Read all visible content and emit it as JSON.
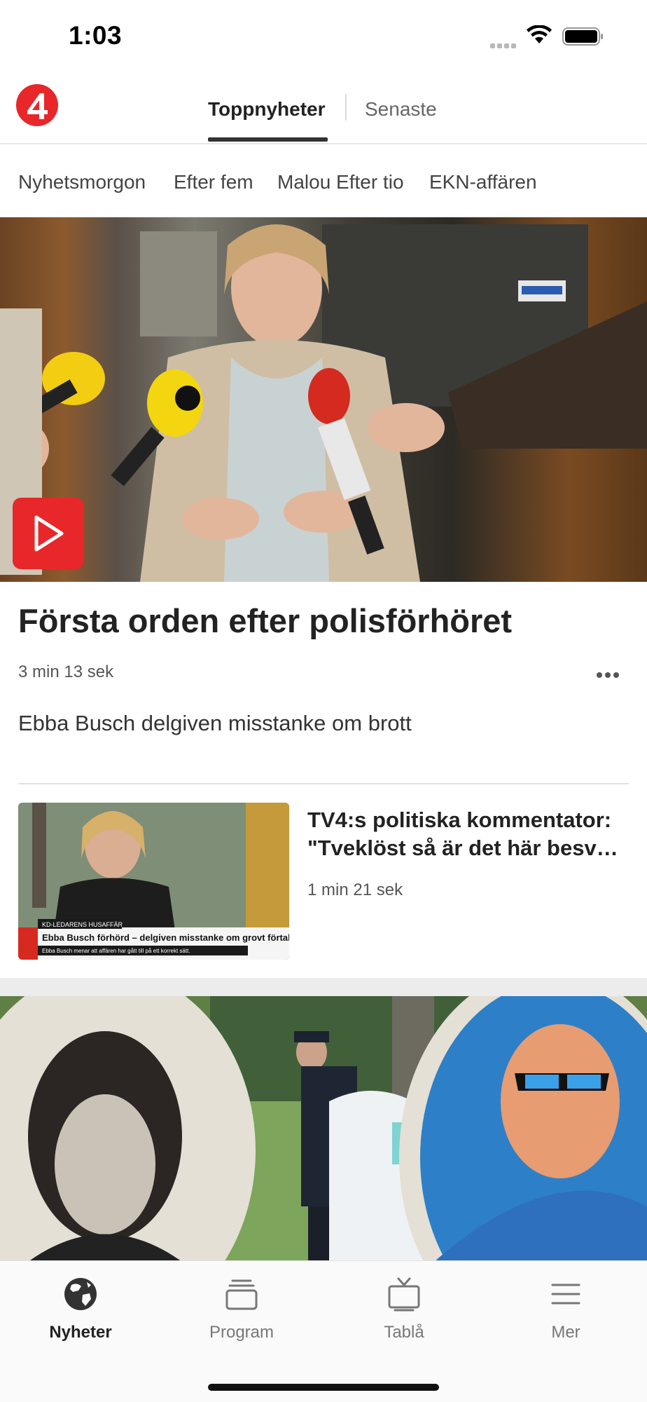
{
  "status_bar": {
    "time": "1:03"
  },
  "header": {
    "logo_icon": "tv4-logo-icon",
    "tabs": [
      {
        "label": "Toppnyheter",
        "active": true
      },
      {
        "label": "Senaste",
        "active": false
      }
    ]
  },
  "subnav": {
    "items": [
      {
        "label": "Nyhetsmorgon"
      },
      {
        "label": "Efter fem"
      },
      {
        "label": "Malou Efter tio"
      },
      {
        "label": "EKN-affären"
      }
    ]
  },
  "hero": {
    "title": "Första orden efter polisförhöret",
    "duration": "3 min 13 sek",
    "subtitle": "Ebba Busch delgiven misstanke om brott",
    "play_icon": "play-icon",
    "more_icon": "more-dots-icon"
  },
  "article2": {
    "title_line1": "TV4:s politiska kommentator:",
    "title_line2": "\"Tveklöst så är det här besv…",
    "duration": "1 min 21 sek",
    "thumb_caption_top": "KD-LEDARENS HUSAFFÄR",
    "thumb_caption_main": "Ebba Busch förhörd – delgiven misstanke om grovt förtal",
    "thumb_caption_sub": "Ebba Busch menar att affären har gått till på ett korrekt sätt."
  },
  "bottom_nav": {
    "items": [
      {
        "label": "Nyheter",
        "icon": "globe-icon",
        "active": true
      },
      {
        "label": "Program",
        "icon": "stack-icon",
        "active": false
      },
      {
        "label": "Tablå",
        "icon": "tv-icon",
        "active": false
      },
      {
        "label": "Mer",
        "icon": "menu-icon",
        "active": false
      }
    ]
  },
  "colors": {
    "brand_red": "#e8272a",
    "text_dark": "#222222",
    "text_muted": "#777777"
  }
}
